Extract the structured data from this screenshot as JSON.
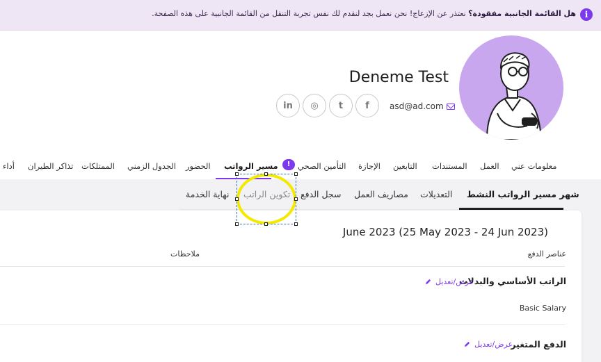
{
  "banner": {
    "title": "هل القائمة الجانبية مفقودة؟",
    "message": "نعتذر عن الإزعاج! نحن نعمل بجد لنقدم لك نفس تجربة التنقل من القائمة الجانبية على هذه الصفحة.",
    "icon": "info-icon"
  },
  "profile": {
    "name": "Deneme Test",
    "email": "asd@ad.com",
    "avatar_bg": "#c9a7ee",
    "social": [
      "facebook",
      "twitter",
      "instagram",
      "linkedin"
    ],
    "social_labels": {
      "facebook": "f",
      "twitter": "t",
      "instagram": "◎",
      "linkedin": "in"
    }
  },
  "tabs": {
    "about": "معلومات عني",
    "work": "العمل",
    "documents": "المستندات",
    "dependents": "التابعين",
    "leave": "الإجازة",
    "health": "التأمين الصحي",
    "badge": "!",
    "payroll": "مسير الرواتب",
    "attendance": "الحضور",
    "timeline": "الجدول الزمني",
    "assets": "الممتلكات",
    "tickets": "تذاكر الطيران",
    "performance": "أداء"
  },
  "subtabs": {
    "active_month": "شهر مسير الرواتب النشط",
    "adjustments": "التعديلات",
    "expenses": "مصاريف العمل",
    "payment_log": "سجل الدفع",
    "salary_setup": "تكوين الراتب",
    "end_of_service": "نهاية الخدمة"
  },
  "content": {
    "period": "June 2023 (25 May 2023 - 24 Jun 2023)",
    "col_payment_items": "عناصر الدفع",
    "col_notes": "ملاحظات",
    "section_basic": "الراتب الأساسي والبدلات",
    "edit_label": "عرض/تعديل",
    "basic_salary": "Basic Salary",
    "section_variable": "الدفع المتغير"
  },
  "colors": {
    "accent": "#7c3aed",
    "banner_bg": "#efe6f5",
    "highlight": "#f3ea00"
  }
}
